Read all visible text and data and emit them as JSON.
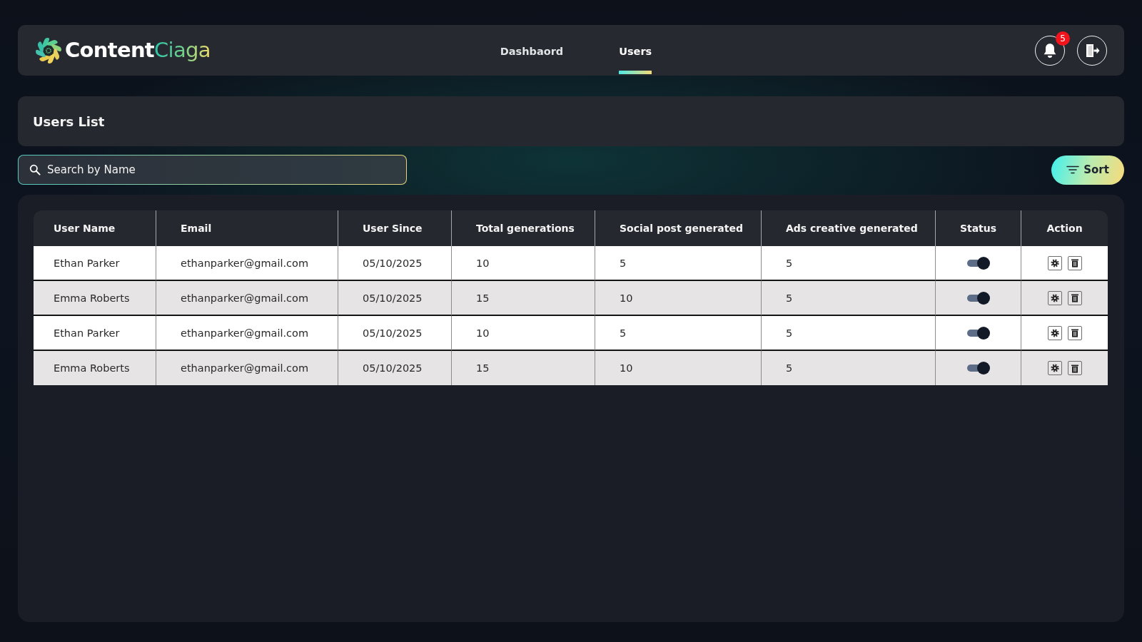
{
  "header": {
    "logo": {
      "part_1": "Content",
      "part_2": "Ciaga"
    },
    "tabs": [
      {
        "label": "Dashbaord",
        "selected": false
      },
      {
        "label": "Users",
        "selected": true
      }
    ],
    "notifications": {
      "badge": "5"
    }
  },
  "page_title": "Users List",
  "search": {
    "placeholder": "Search by Name"
  },
  "sort_button": {
    "label": "Sort"
  },
  "table": {
    "columns": [
      "User Name",
      "Email",
      "User Since",
      "Total generations",
      "Social post generated",
      "Ads creative generated",
      "Status",
      "Action"
    ],
    "rows": [
      {
        "cells": [
          "Ethan Parker",
          "ethanparker@gmail.com",
          "05/10/2025",
          "10",
          "5",
          "5"
        ],
        "on": true
      },
      {
        "cells": [
          "Emma Roberts",
          "ethanparker@gmail.com",
          "05/10/2025",
          "15",
          "10",
          "5"
        ],
        "on": true
      },
      {
        "cells": [
          "Ethan Parker",
          "ethanparker@gmail.com",
          "05/10/2025",
          "10",
          "5",
          "5"
        ],
        "on": true
      },
      {
        "cells": [
          "Emma Roberts",
          "ethanparker@gmail.com",
          "05/10/2025",
          "15",
          "10",
          "5"
        ],
        "on": true
      }
    ]
  }
}
